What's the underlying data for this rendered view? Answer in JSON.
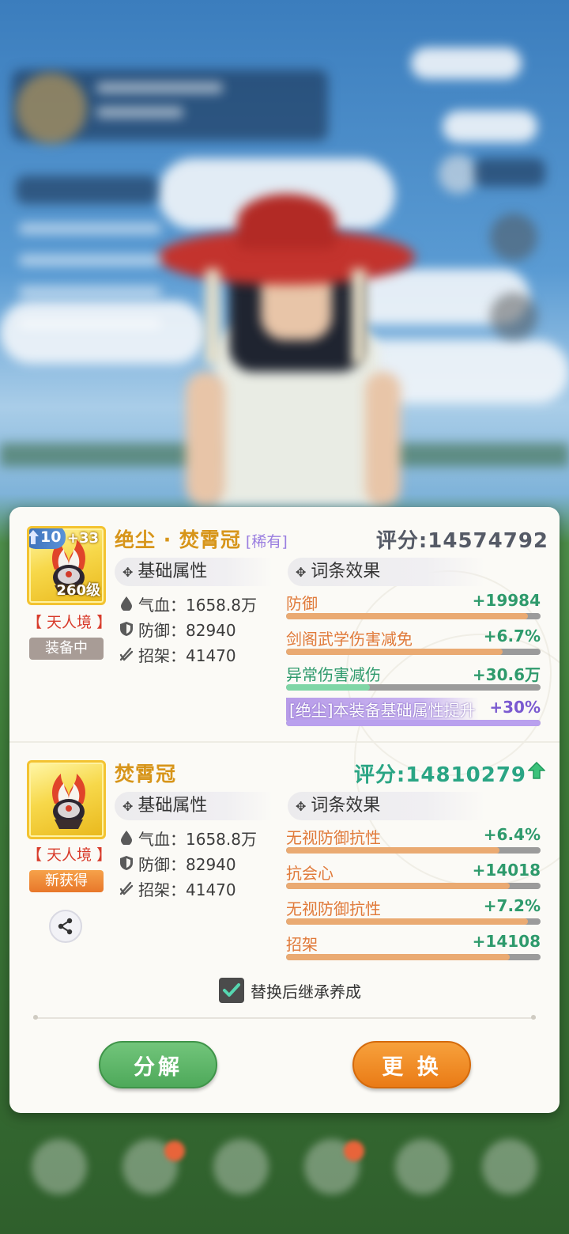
{
  "colors": {
    "accent_gold": "#d7951a",
    "realm_red": "#d83b2b",
    "positive_green": "#2aa584",
    "affix_orange": "#e07a3a",
    "rare_purple": "#9a7ee0",
    "decompose_green": "#4ea95a",
    "replace_orange": "#ea7b16"
  },
  "current_item": {
    "icon": "flame-crown-icon",
    "enhance_level": "10",
    "refine_bonus": "+33",
    "item_level": "260级",
    "name": "绝尘 · 焚霄冠",
    "rarity": "[稀有]",
    "score": "评分:14574792",
    "realm": "【 天人境 】",
    "status": "装备中",
    "base_header": "基础属性",
    "base_stats": [
      {
        "icon": "blood-drop-icon",
        "text": "气血：1658.8万"
      },
      {
        "icon": "shield-icon",
        "text": "防御：82940"
      },
      {
        "icon": "parry-icon",
        "text": "招架：41470"
      }
    ],
    "affix_header": "词条效果",
    "affixes": [
      {
        "label": "防御",
        "value": "+19984",
        "fill": 0.95,
        "color": "#eaaa72",
        "style": "orange"
      },
      {
        "label": "剑阁武学伤害减免",
        "value": "+6.7%",
        "fill": 0.85,
        "color": "#eaaa72",
        "style": "orange"
      },
      {
        "label": "异常伤害减伤",
        "value": "+30.6万",
        "fill": 0.33,
        "color": "#7fd6a6",
        "style": "green"
      },
      {
        "label": "[绝尘]本装备基础属性提升",
        "value": "+30%",
        "fill": 1.0,
        "color": "#b9a0ee",
        "style": "purple"
      }
    ]
  },
  "new_item": {
    "icon": "flame-crown-icon",
    "name": "焚霄冠",
    "score": "评分:14810279",
    "realm": "【 天人境 】",
    "status": "新获得",
    "base_header": "基础属性",
    "base_stats": [
      {
        "icon": "blood-drop-icon",
        "text": "气血：1658.8万"
      },
      {
        "icon": "shield-icon",
        "text": "防御：82940"
      },
      {
        "icon": "parry-icon",
        "text": "招架：41470"
      }
    ],
    "affix_header": "词条效果",
    "affixes": [
      {
        "label": "无视防御抗性",
        "value": "+6.4%",
        "fill": 0.84,
        "color": "#eaaa72",
        "style": "orange"
      },
      {
        "label": "抗会心",
        "value": "+14018",
        "fill": 0.88,
        "color": "#eaaa72",
        "style": "orange"
      },
      {
        "label": "无视防御抗性",
        "value": "+7.2%",
        "fill": 0.95,
        "color": "#eaaa72",
        "style": "orange"
      },
      {
        "label": "招架",
        "value": "+14108",
        "fill": 0.88,
        "color": "#eaaa72",
        "style": "orange"
      }
    ]
  },
  "inherit_checkbox": {
    "label": "替换后继承养成",
    "checked": true
  },
  "buttons": {
    "decompose": "分解",
    "replace": "更 换"
  }
}
